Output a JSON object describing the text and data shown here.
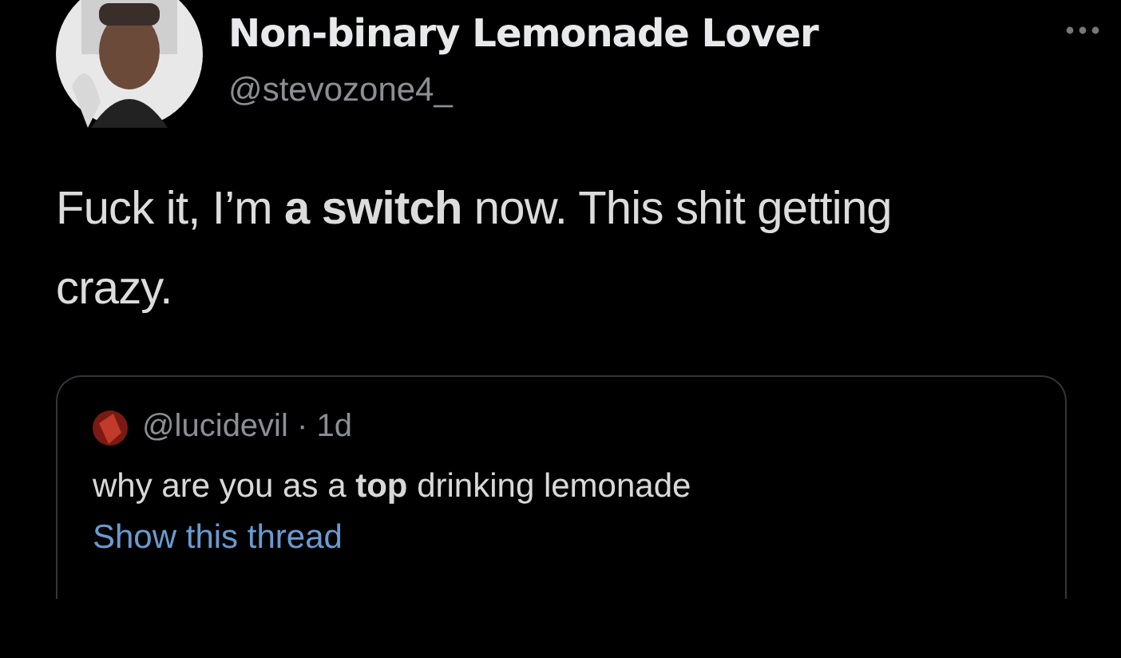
{
  "tweet": {
    "author": {
      "name": "Non-binary Lemonade Lover",
      "handle": "@stevozone4_"
    },
    "text": "Fuck it, I’m **a switch** now. This shit getting crazy.",
    "quoted": {
      "byline": "@lucidevil · 1d",
      "text": "why are you as a **top** drinking lemonade",
      "link": "Show this thread"
    }
  }
}
